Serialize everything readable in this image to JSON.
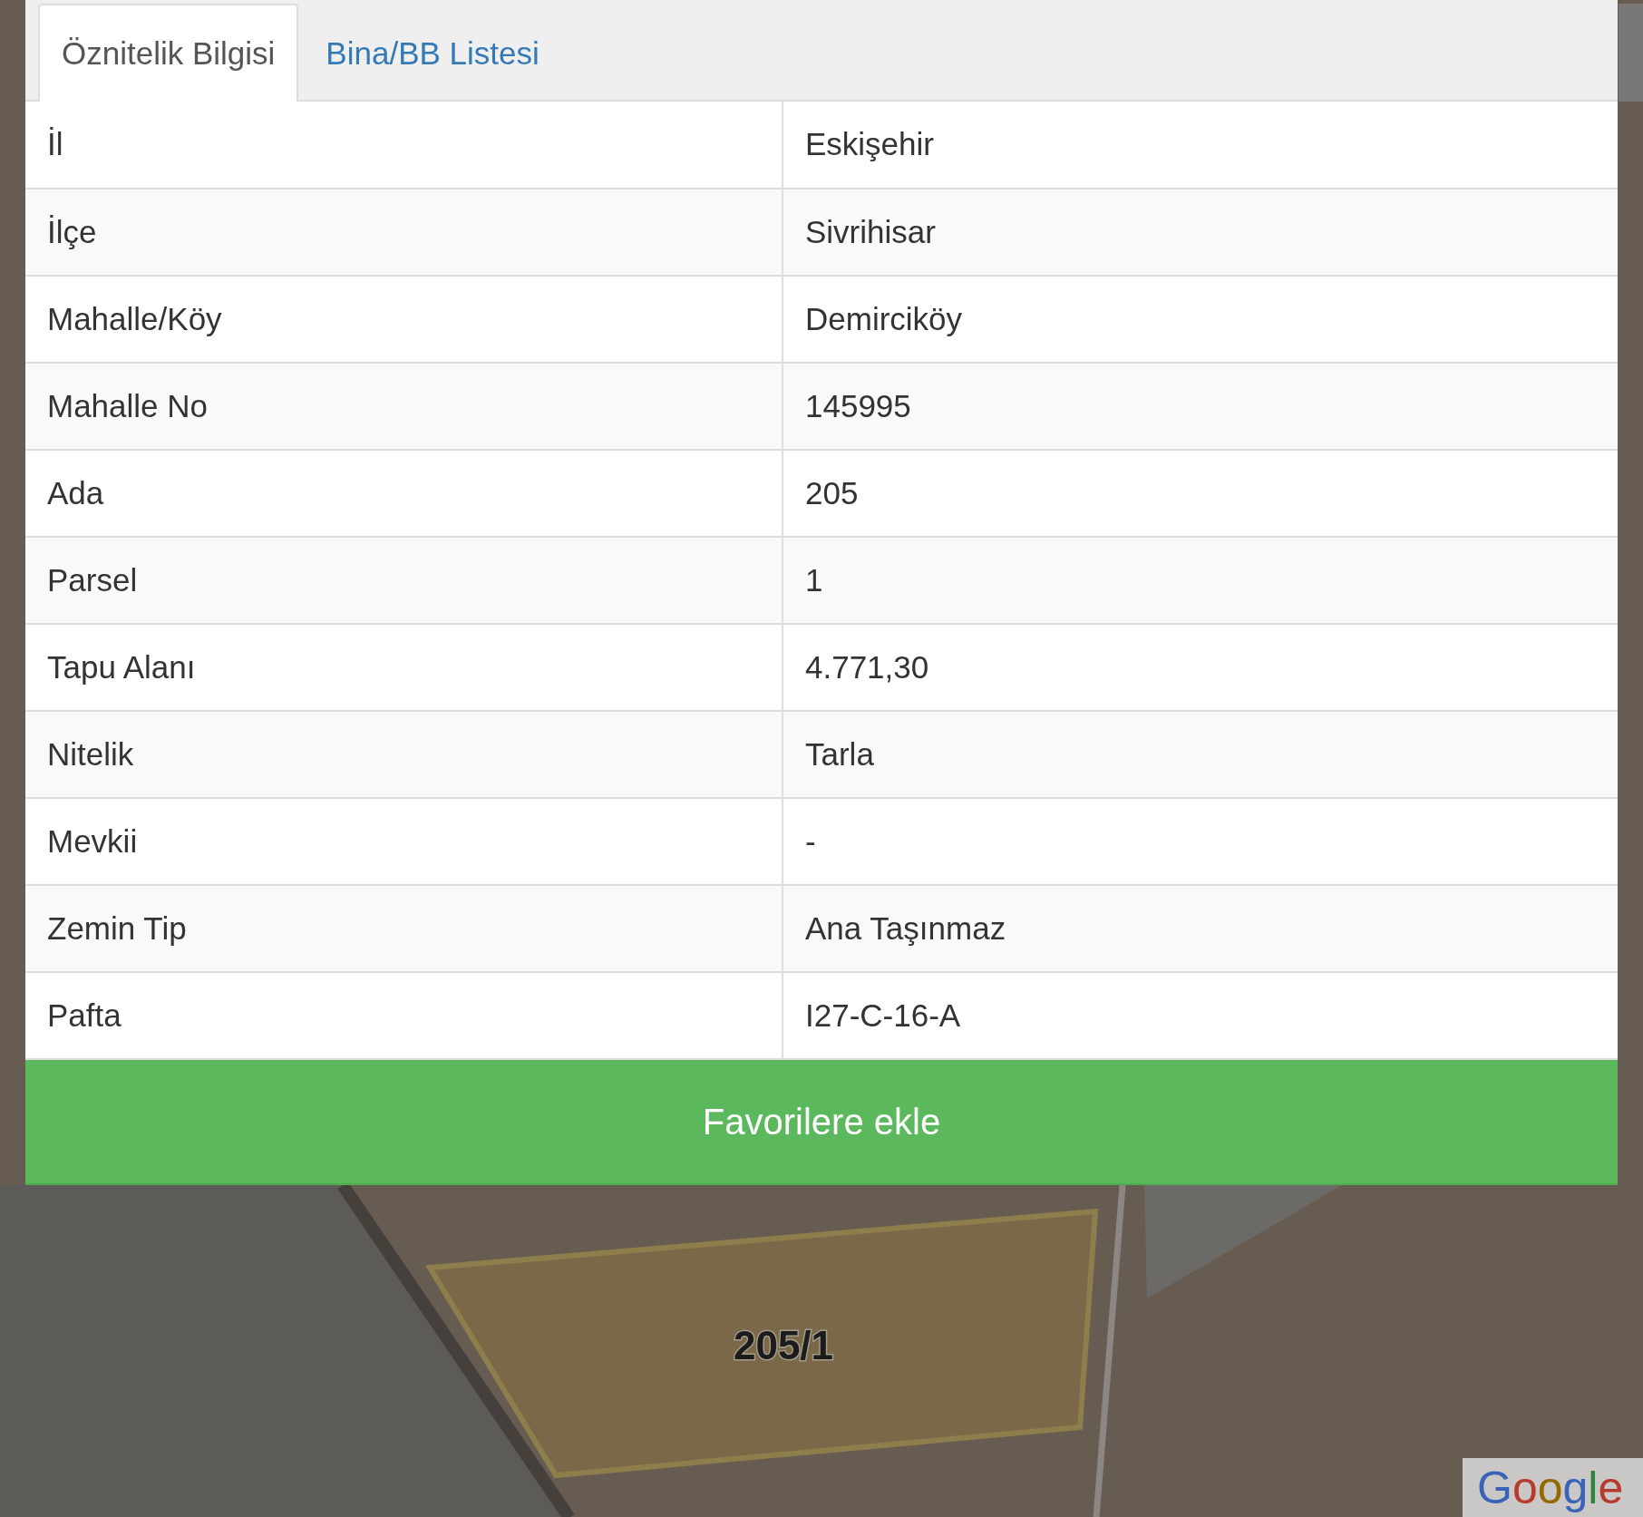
{
  "tabs": [
    {
      "label": "Öznitelik Bilgisi",
      "selected": true
    },
    {
      "label": "Bina/BB Listesi",
      "selected": false
    }
  ],
  "table": {
    "rows": [
      {
        "label": "İl",
        "value": "Eskişehir"
      },
      {
        "label": "İlçe",
        "value": "Sivrihisar"
      },
      {
        "label": "Mahalle/Köy",
        "value": "Demirciköy"
      },
      {
        "label": "Mahalle No",
        "value": "145995"
      },
      {
        "label": "Ada",
        "value": "205"
      },
      {
        "label": "Parsel",
        "value": "1"
      },
      {
        "label": "Tapu Alanı",
        "value": "4.771,30"
      },
      {
        "label": "Nitelik",
        "value": "Tarla"
      },
      {
        "label": "Mevkii",
        "value": "-"
      },
      {
        "label": "Zemin Tip",
        "value": "Ana Taşınmaz"
      },
      {
        "label": "Pafta",
        "value": "I27-C-16-A"
      }
    ]
  },
  "favorite_button": {
    "label": "Favorilere ekle"
  },
  "map": {
    "parcel_label": "205/1",
    "attribution_logo": "Google"
  }
}
